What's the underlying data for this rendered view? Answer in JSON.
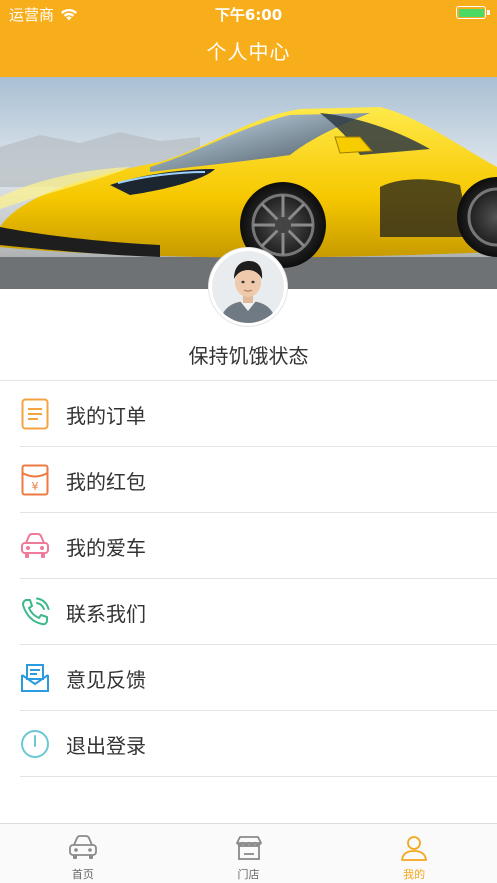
{
  "status_bar": {
    "carrier": "运营商",
    "time": "下午6:00",
    "battery_level": 1.0
  },
  "nav": {
    "title": "个人中心"
  },
  "profile": {
    "username": "保持饥饿状态"
  },
  "menu": {
    "items": [
      {
        "label": "我的订单",
        "icon": "order-list-icon",
        "color": "#f4a342"
      },
      {
        "label": "我的红包",
        "icon": "red-envelope-icon",
        "color": "#ee7a42"
      },
      {
        "label": "我的爱车",
        "icon": "car-icon",
        "color": "#f07a9a"
      },
      {
        "label": "联系我们",
        "icon": "phone-icon",
        "color": "#3cb98a"
      },
      {
        "label": "意见反馈",
        "icon": "feedback-mail-icon",
        "color": "#2b9be0"
      },
      {
        "label": "退出登录",
        "icon": "power-icon",
        "color": "#6cc9d4"
      }
    ]
  },
  "tabbar": {
    "tabs": [
      {
        "label": "首页",
        "icon": "car-front-icon",
        "active": false
      },
      {
        "label": "门店",
        "icon": "store-icon",
        "active": false
      },
      {
        "label": "我的",
        "icon": "user-icon",
        "active": true
      }
    ]
  },
  "colors": {
    "accent": "#f8ae1a",
    "active_tab": "#f4a61c",
    "text": "#333333"
  }
}
